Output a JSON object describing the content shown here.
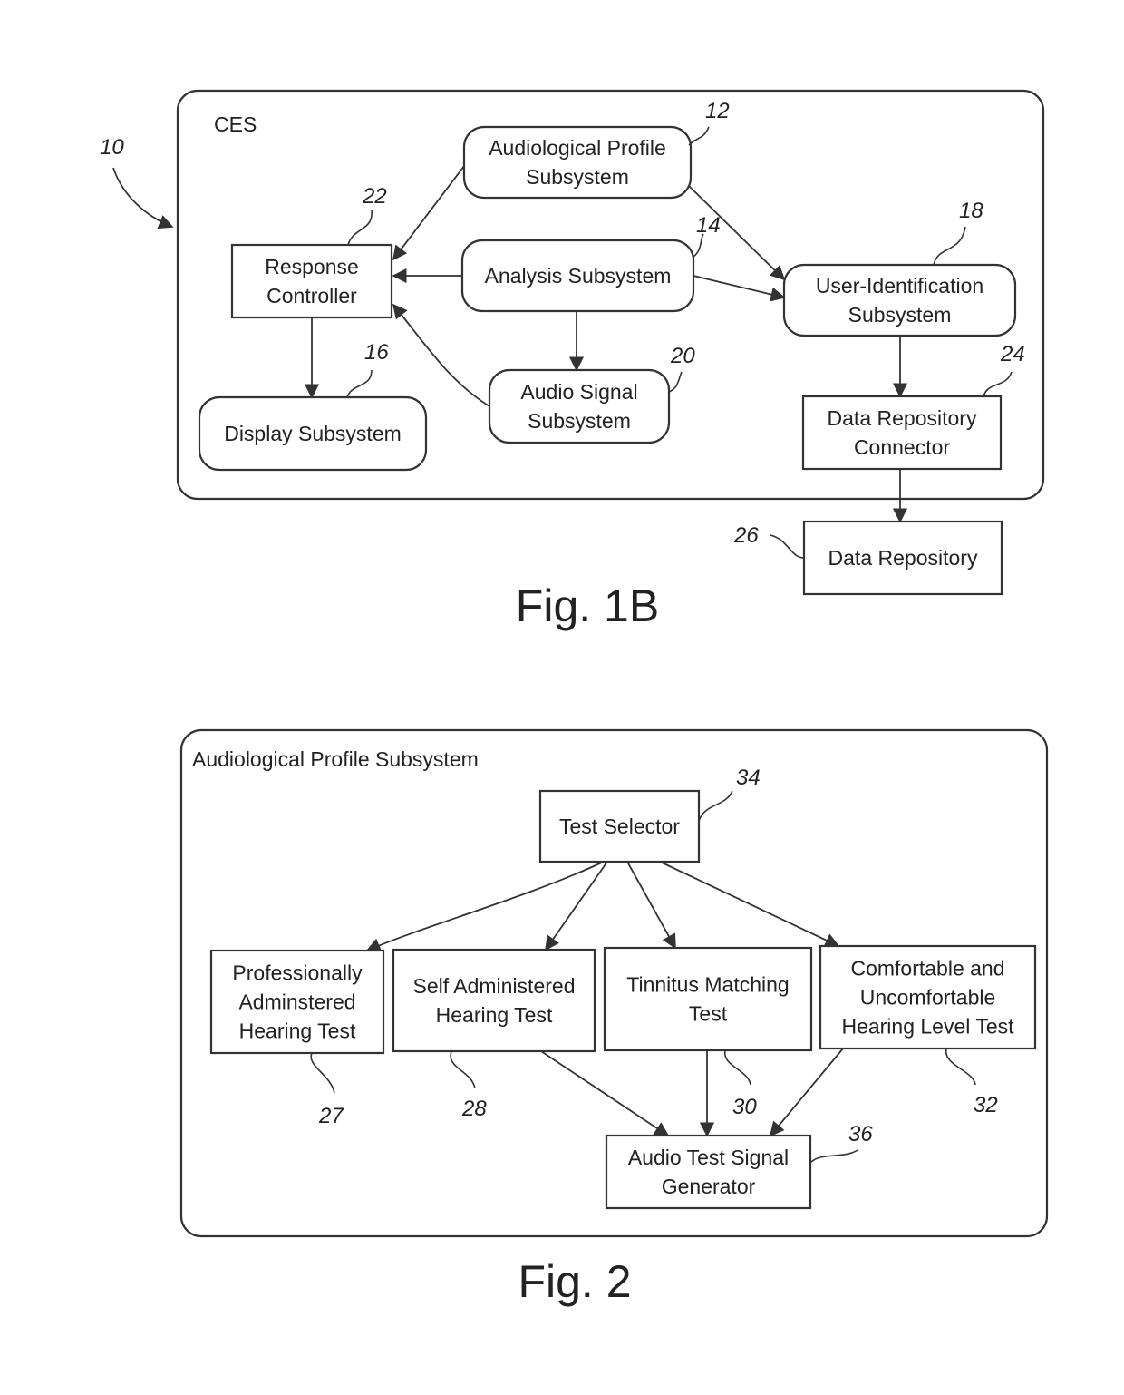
{
  "fig1b": {
    "caption": "Fig. 1B",
    "container": {
      "label": "CES",
      "ref": "10"
    },
    "nodes": {
      "audiological_profile": {
        "lines": [
          "Audiological Profile",
          "Subsystem"
        ],
        "ref": "12"
      },
      "analysis": {
        "lines": [
          "Analysis Subsystem"
        ],
        "ref": "14"
      },
      "display": {
        "lines": [
          "Display Subsystem"
        ],
        "ref": "16"
      },
      "user_identification": {
        "lines": [
          "User-Identification",
          "Subsystem"
        ],
        "ref": "18"
      },
      "audio_signal": {
        "lines": [
          "Audio Signal",
          "Subsystem"
        ],
        "ref": "20"
      },
      "response_controller": {
        "lines": [
          "Response",
          "Controller"
        ],
        "ref": "22"
      },
      "data_repository_connector": {
        "lines": [
          "Data Repository",
          "Connector"
        ],
        "ref": "24"
      },
      "data_repository": {
        "lines": [
          "Data Repository"
        ],
        "ref": "26"
      }
    },
    "edges": [
      {
        "from": "audiological_profile",
        "to": "response_controller"
      },
      {
        "from": "analysis",
        "to": "response_controller"
      },
      {
        "from": "audio_signal",
        "to": "response_controller"
      },
      {
        "from": "analysis",
        "to": "audio_signal"
      },
      {
        "from": "response_controller",
        "to": "display"
      },
      {
        "from": "audiological_profile",
        "to": "user_identification"
      },
      {
        "from": "analysis",
        "to": "user_identification"
      },
      {
        "from": "user_identification",
        "to": "data_repository_connector"
      },
      {
        "from": "data_repository_connector",
        "to": "data_repository"
      }
    ]
  },
  "fig2": {
    "caption": "Fig. 2",
    "container": {
      "label": "Audiological Profile Subsystem"
    },
    "nodes": {
      "test_selector": {
        "lines": [
          "Test Selector"
        ],
        "ref": "34"
      },
      "professional_test": {
        "lines": [
          "Professionally",
          "Adminstered",
          "Hearing Test"
        ],
        "ref": "27"
      },
      "self_test": {
        "lines": [
          "Self Administered",
          "Hearing Test"
        ],
        "ref": "28"
      },
      "tinnitus_test": {
        "lines": [
          "Tinnitus Matching",
          "Test"
        ],
        "ref": "30"
      },
      "comfort_test": {
        "lines": [
          "Comfortable and",
          "Uncomfortable",
          "Hearing Level Test"
        ],
        "ref": "32"
      },
      "signal_generator": {
        "lines": [
          "Audio Test Signal",
          "Generator"
        ],
        "ref": "36"
      }
    },
    "edges": [
      {
        "from": "test_selector",
        "to": "professional_test"
      },
      {
        "from": "test_selector",
        "to": "self_test"
      },
      {
        "from": "test_selector",
        "to": "tinnitus_test"
      },
      {
        "from": "test_selector",
        "to": "comfort_test"
      },
      {
        "from": "self_test",
        "to": "signal_generator"
      },
      {
        "from": "tinnitus_test",
        "to": "signal_generator"
      },
      {
        "from": "comfort_test",
        "to": "signal_generator"
      }
    ]
  }
}
